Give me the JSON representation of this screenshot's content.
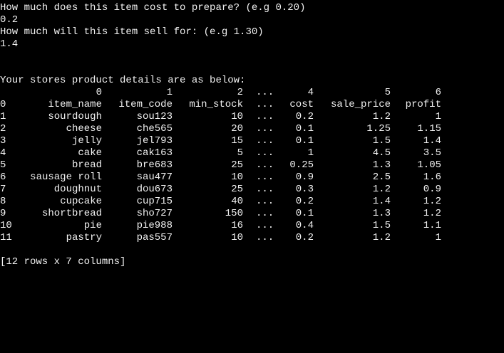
{
  "prompts": {
    "cost_question": "How much does this item cost to prepare? (e.g 0.20)",
    "cost_answer": "0.2",
    "sale_question": "How much will this item sell for: (e.g 1.30)",
    "sale_answer": "1.4",
    "details_heading": "Your stores product details are as below:"
  },
  "table": {
    "column_numbers": [
      "0",
      "1",
      "2",
      "...",
      "4",
      "5",
      "6"
    ],
    "header_index": "0",
    "headers": [
      "item_name",
      "item_code",
      "min_stock",
      "...",
      "cost",
      "sale_price",
      "profit"
    ],
    "rows": [
      {
        "idx": "1",
        "item_name": "sourdough",
        "item_code": "sou123",
        "min_stock": "10",
        "dots": "...",
        "cost": "0.2",
        "sale_price": "1.2",
        "profit": "1"
      },
      {
        "idx": "2",
        "item_name": "cheese",
        "item_code": "che565",
        "min_stock": "20",
        "dots": "...",
        "cost": "0.1",
        "sale_price": "1.25",
        "profit": "1.15"
      },
      {
        "idx": "3",
        "item_name": "jelly",
        "item_code": "jel793",
        "min_stock": "15",
        "dots": "...",
        "cost": "0.1",
        "sale_price": "1.5",
        "profit": "1.4"
      },
      {
        "idx": "4",
        "item_name": "cake",
        "item_code": "cak163",
        "min_stock": "5",
        "dots": "...",
        "cost": "1",
        "sale_price": "4.5",
        "profit": "3.5"
      },
      {
        "idx": "5",
        "item_name": "bread",
        "item_code": "bre683",
        "min_stock": "25",
        "dots": "...",
        "cost": "0.25",
        "sale_price": "1.3",
        "profit": "1.05"
      },
      {
        "idx": "6",
        "item_name": "sausage roll",
        "item_code": "sau477",
        "min_stock": "10",
        "dots": "...",
        "cost": "0.9",
        "sale_price": "2.5",
        "profit": "1.6"
      },
      {
        "idx": "7",
        "item_name": "doughnut",
        "item_code": "dou673",
        "min_stock": "25",
        "dots": "...",
        "cost": "0.3",
        "sale_price": "1.2",
        "profit": "0.9"
      },
      {
        "idx": "8",
        "item_name": "cupcake",
        "item_code": "cup715",
        "min_stock": "40",
        "dots": "...",
        "cost": "0.2",
        "sale_price": "1.4",
        "profit": "1.2"
      },
      {
        "idx": "9",
        "item_name": "shortbread",
        "item_code": "sho727",
        "min_stock": "150",
        "dots": "...",
        "cost": "0.1",
        "sale_price": "1.3",
        "profit": "1.2"
      },
      {
        "idx": "10",
        "item_name": "pie",
        "item_code": "pie988",
        "min_stock": "16",
        "dots": "...",
        "cost": "0.4",
        "sale_price": "1.5",
        "profit": "1.1"
      },
      {
        "idx": "11",
        "item_name": "pastry",
        "item_code": "pas557",
        "min_stock": "10",
        "dots": "...",
        "cost": "0.2",
        "sale_price": "1.2",
        "profit": "1"
      }
    ],
    "footer": "[12 rows x 7 columns]"
  },
  "colors": {
    "background": "#000000",
    "text": "#f2f2f2"
  }
}
